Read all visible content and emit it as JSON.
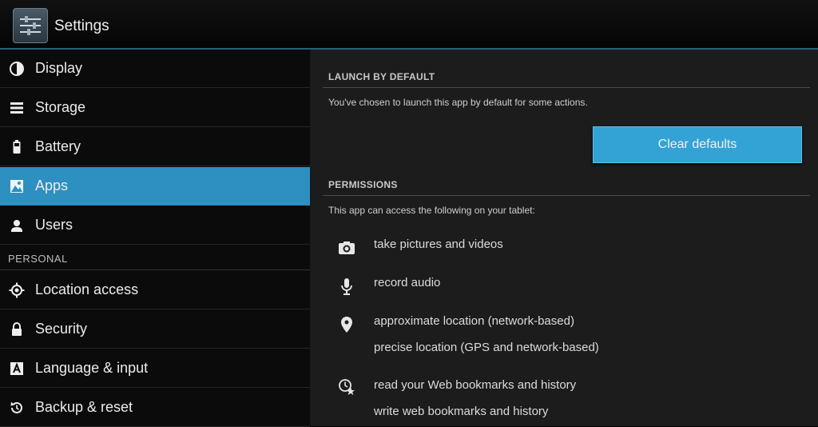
{
  "window": {
    "title": "Settings",
    "app_icon": "settings-app-icon"
  },
  "sidebar": {
    "items": [
      {
        "label": "Display",
        "icon": "display-brightness-icon"
      },
      {
        "label": "Storage",
        "icon": "storage-icon"
      },
      {
        "label": "Battery",
        "icon": "battery-icon"
      },
      {
        "label": "Apps",
        "icon": "apps-icon",
        "selected": true
      },
      {
        "label": "Users",
        "icon": "users-icon"
      }
    ],
    "section_personal": "PERSONAL",
    "personal_items": [
      {
        "label": "Location access",
        "icon": "location-access-icon"
      },
      {
        "label": "Security",
        "icon": "lock-icon"
      },
      {
        "label": "Language & input",
        "icon": "language-icon"
      },
      {
        "label": "Backup & reset",
        "icon": "backup-reset-icon"
      }
    ]
  },
  "main": {
    "launch_default": {
      "title": "LAUNCH BY DEFAULT",
      "description": "You've chosen to launch this app by default for some actions.",
      "clear_button": "Clear defaults"
    },
    "permissions": {
      "title": "PERMISSIONS",
      "description": "This app can access the following on your tablet:",
      "groups": [
        {
          "icon": "camera-icon",
          "items": [
            "take pictures and videos"
          ]
        },
        {
          "icon": "microphone-icon",
          "items": [
            "record audio"
          ]
        },
        {
          "icon": "location-pin-icon",
          "items": [
            "approximate location (network-based)",
            "precise location (GPS and network-based)"
          ]
        },
        {
          "icon": "bookmark-history-icon",
          "items": [
            "read your Web bookmarks and history",
            "write web bookmarks and history"
          ]
        }
      ]
    }
  },
  "colors": {
    "accent": "#2e8fc1",
    "button": "#32a3d4",
    "content_bg": "#1c1c1c",
    "sidebar_bg": "#0b0b0b"
  }
}
